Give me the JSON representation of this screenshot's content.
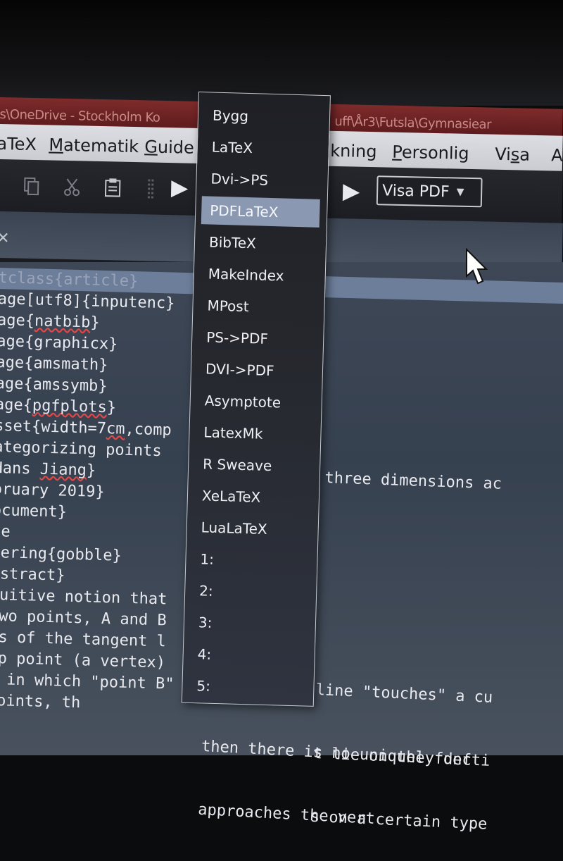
{
  "window": {
    "title_left": "s\\OneDrive - Stockholm Ko",
    "title_right": "uff\\År3\\Futsla\\Gymnasiear"
  },
  "menubar": {
    "items": [
      {
        "label": "aTeX"
      },
      {
        "label_pre": "",
        "label_ul": "M",
        "label_post": "atematik"
      },
      {
        "label_pre": "",
        "label_ul": "G",
        "label_post": "uide"
      },
      {
        "label": "kning"
      },
      {
        "label_pre": "",
        "label_ul": "P",
        "label_post": "ersonlig"
      },
      {
        "label_pre": "Vi",
        "label_ul": "s",
        "label_post": "a"
      },
      {
        "label": "A"
      }
    ]
  },
  "toolbar": {
    "view_button": "Visa PDF"
  },
  "compile_menu": {
    "items": [
      {
        "label": "Bygg",
        "selected": false
      },
      {
        "label": "LaTeX",
        "selected": false
      },
      {
        "label": "Dvi->PS",
        "selected": false
      },
      {
        "label": "PDFLaTeX",
        "selected": true
      },
      {
        "label": "BibTeX",
        "selected": false
      },
      {
        "label": "MakeIndex",
        "selected": false
      },
      {
        "label": "MPost",
        "selected": false
      },
      {
        "label": "PS->PDF",
        "selected": false
      },
      {
        "label": "DVI->PDF",
        "selected": false
      },
      {
        "label": "Asymptote",
        "selected": false
      },
      {
        "label": "LatexMk",
        "selected": false
      },
      {
        "label": "R Sweave",
        "selected": false
      },
      {
        "label": "XeLaTeX",
        "selected": false
      },
      {
        "label": "LuaLaTeX",
        "selected": false
      },
      {
        "label": "1:",
        "selected": false
      },
      {
        "label": "2:",
        "selected": false
      },
      {
        "label": "3:",
        "selected": false
      },
      {
        "label": "4:",
        "selected": false
      },
      {
        "label": "5:",
        "selected": false
      }
    ]
  },
  "editor": {
    "lines": [
      {
        "pre": "tclass{article}",
        "sq": "",
        "post": "",
        "highlight": true
      },
      {
        "pre": "age[utf8]{inputenc}",
        "sq": "",
        "post": "",
        "highlight": false
      },
      {
        "pre": "age{",
        "sq": "natbib",
        "post": "}",
        "highlight": false
      },
      {
        "pre": "age{graphicx}",
        "sq": "",
        "post": "",
        "highlight": false
      },
      {
        "pre": "age{amsmath}",
        "sq": "",
        "post": "",
        "highlight": false
      },
      {
        "pre": "age{amssymb}",
        "sq": "",
        "post": "",
        "highlight": false
      },
      {
        "pre": "age{",
        "sq": "pgfplots",
        "post": "}",
        "highlight": false
      },
      {
        "pre": "sset{width=7",
        "sq": "cm",
        "post": ",comp",
        "highlight": false
      },
      {
        "pre": "ategorizing points",
        "sq": "",
        "post": "",
        "highlight": false
      },
      {
        "pre": "Hans ",
        "sq": "Jiang",
        "post": "}",
        "highlight": false
      },
      {
        "pre": "oruary 2019}",
        "sq": "",
        "post": "",
        "highlight": false
      },
      {
        "pre": "ocument}",
        "sq": "",
        "post": "",
        "highlight": false
      },
      {
        "pre": "le",
        "sq": "",
        "post": "",
        "highlight": false
      },
      {
        "pre": "oering{gobble}",
        "sq": "",
        "post": "",
        "highlight": false
      },
      {
        "pre": "ostract}",
        "sq": "",
        "post": "",
        "highlight": false
      },
      {
        "pre": "cuitive notion that",
        "sq": "",
        "post": "",
        "highlight": false
      },
      {
        "pre": "two points, A and B",
        "sq": "",
        "post": "",
        "highlight": false
      },
      {
        "pre": "es of the tangent l",
        "sq": "",
        "post": "",
        "highlight": false
      },
      {
        "pre": "rp point (a vertex)",
        "sq": "",
        "post": "",
        "highlight": false
      },
      {
        "pre": "n in which \"point B\"",
        "sq": "",
        "post": "",
        "highlight": false
      },
      {
        "pre": "points, th",
        "sq": "",
        "post": "",
        "highlight": false
      }
    ],
    "right_fragment": "three dimensions ac",
    "right_lower": [
      "line \"touches\" a cu",
      "t lie on the functi",
      "s on a certain type"
    ],
    "bottom_lines": [
      "then there is no uniquely def",
      "approaches the vert"
    ]
  }
}
